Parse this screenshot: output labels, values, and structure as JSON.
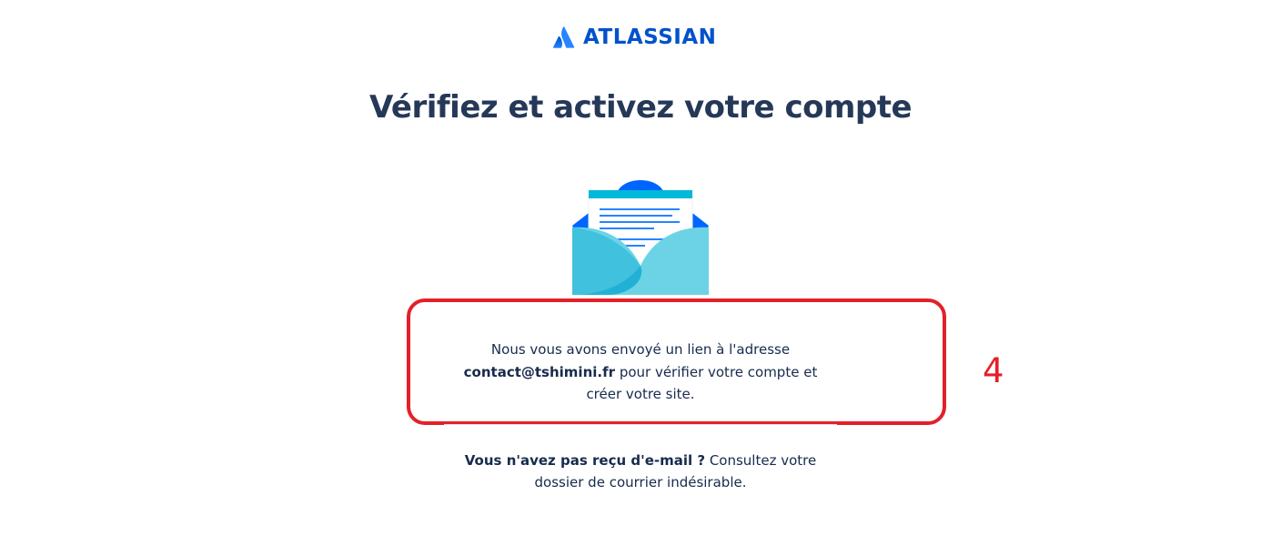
{
  "brand": {
    "name": "ATLASSIAN",
    "color": "#0052CC"
  },
  "title": "Vérifiez et activez votre compte",
  "illustration": {
    "icon": "open-envelope-icon"
  },
  "message": {
    "before": "Nous vous avons envoyé un lien à l'adresse",
    "email": "contact@tshimini.fr",
    "after": "pour vérifier votre compte et créer votre site."
  },
  "annotation": {
    "step_number": "4",
    "color": "#E3202A"
  },
  "spam_note": {
    "bold": "Vous n'avez pas reçu d'e-mail ?",
    "text": "Consultez votre dossier de courrier indésirable."
  }
}
